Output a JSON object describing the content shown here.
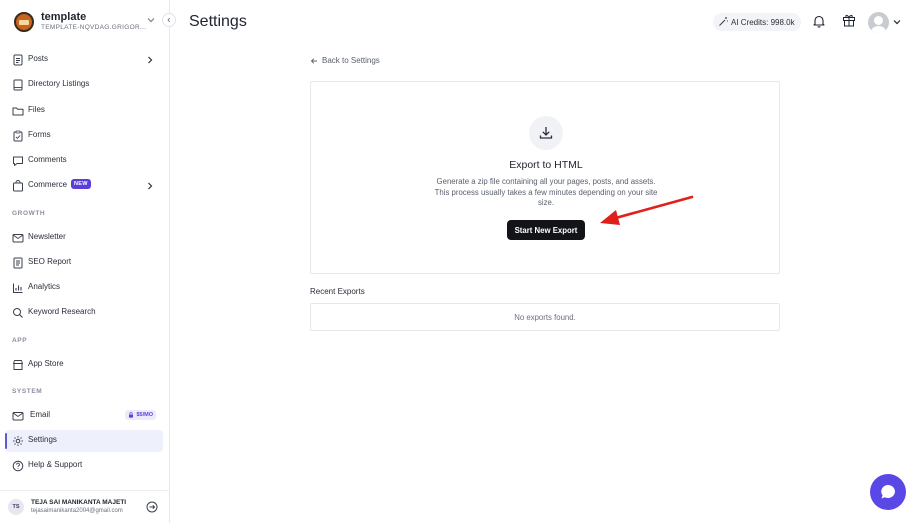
{
  "workspace": {
    "name": "template",
    "subtitle": "TEMPLATE-NQVDAG.GRIGOR..."
  },
  "sidebar": {
    "items": [
      {
        "label": "Posts"
      },
      {
        "label": "Directory Listings"
      },
      {
        "label": "Files"
      },
      {
        "label": "Forms"
      },
      {
        "label": "Comments"
      },
      {
        "label": "Commerce",
        "badge": "NEW"
      }
    ],
    "growth_label": "GROWTH",
    "growth": [
      {
        "label": "Newsletter"
      },
      {
        "label": "SEO Report"
      },
      {
        "label": "Analytics"
      },
      {
        "label": "Keyword Research"
      }
    ],
    "app_label": "APP",
    "app": [
      {
        "label": "App Store"
      }
    ],
    "system_label": "SYSTEM",
    "system": [
      {
        "label": "Email",
        "badge": "$5/MO"
      },
      {
        "label": "Settings"
      },
      {
        "label": "Help & Support"
      }
    ]
  },
  "user": {
    "initials": "TS",
    "name": "TEJA SAI MANIKANTA MAJETI",
    "email": "tejasaimanikanta2004@gmail.com"
  },
  "header": {
    "title": "Settings",
    "credits": "AI Credits: 998.0k"
  },
  "main": {
    "back_label": "Back to Settings",
    "export_title": "Export to HTML",
    "export_description": "Generate a zip file containing all your pages, posts, and assets. This process usually takes a few minutes depending on your site size.",
    "export_button": "Start New Export",
    "recent_title": "Recent Exports",
    "empty_text": "No exports found."
  },
  "colors": {
    "accent": "#5a48e6",
    "active_bg": "#eef0fb",
    "button_bg": "#121418",
    "annotation": "#e0201b"
  }
}
